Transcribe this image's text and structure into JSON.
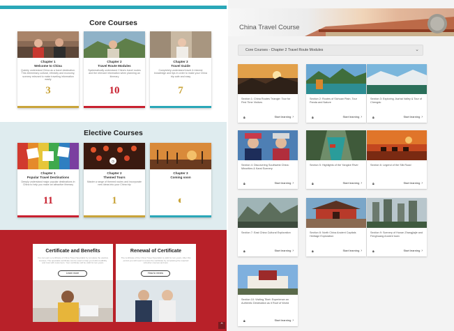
{
  "left_page": {
    "core": {
      "title": "Core Courses",
      "cards": [
        {
          "chapter": "Chapter 1",
          "name": "Welcome to China",
          "desc": "Quickly understand China as a travel destination. This elementary cultural, ethnicity and economy, scenery relevant to make traveling information easily",
          "number": "3",
          "number_color": "#c9a43a",
          "bar_color": "#c9a43a"
        },
        {
          "chapter": "Chapter 2",
          "name": "Travel Route Modules",
          "desc": "Systematically understand China's travel routes and the relevant information when planning an itinerary",
          "number": "10",
          "number_color": "#c8202f",
          "bar_color": "#c8202f"
        },
        {
          "chapter": "Chapter 3",
          "name": "Travel Guide",
          "desc": "Completely understand travel & interest knowledge and tips in order to make your China trip safe and easy",
          "number": "7",
          "number_color": "#c9a43a",
          "bar_color": "#2aa7b8"
        }
      ]
    },
    "elective": {
      "title": "Elective Courses",
      "cards": [
        {
          "chapter": "Chapter 1",
          "name": "Popular Travel Destinations",
          "desc": "Deeply understand major popular destinations in China to help you make an attractive itinerary",
          "number": "11",
          "number_color": "#c8202f",
          "bar_color": "#c8202f"
        },
        {
          "chapter": "Chapter 2",
          "name": "Themed Tours",
          "desc": "Master a range of themed routes and incorporate new ideas into your China trip",
          "number": "1",
          "number_color": "#c9a43a",
          "bar_color": "#c9a43a"
        },
        {
          "chapter": "Chapter 3",
          "name": "Coming soon",
          "desc": "",
          "number": "◐",
          "number_color": "#c9a43a",
          "bar_color": "#2aa7b8"
        }
      ]
    },
    "certificates": [
      {
        "title": "Certificate and Benefits",
        "text": "You can earn a certificate of China Travel Specialist by complete the elective courses. The specialist certificate can be used to help you build credibility and trust with customers. Your certificate will be valid for two years.",
        "button": "Learn more"
      },
      {
        "title": "Renewal of Certificate",
        "text": "The certificate of the China Travel Specialist is valid for two years. After this period you will need to renew the certificate by completing the required refresher courses and test.",
        "button": "How to renew"
      }
    ]
  },
  "right_page": {
    "banner_title": "China Travel Course",
    "dropdown_label": "Core Courses - Chapter 2 Travel Route Modules",
    "tiles": [
      {
        "text": "Section 1: China Routes Triangle: Tour for First Time Visitors",
        "action": "Start learning"
      },
      {
        "text": "Section 2: Routes of Sichuan Plain, Tour Panda and Nature",
        "action": "Start learning"
      },
      {
        "text": "Section 3: Exploring Jiuzhai Valley & Tour of Chengdu",
        "action": "Start learning"
      },
      {
        "text": "Section 4: Discovering Southwest China: Minorities & Karst Scenery",
        "action": "Start learning"
      },
      {
        "text": "Section 5: Highlights of the Yangtze River",
        "action": "Start learning"
      },
      {
        "text": "Section 6: Legend of the Silk Road",
        "action": "Start learning"
      },
      {
        "text": "Section 7: East China Cultural Exploration",
        "action": "Start learning"
      },
      {
        "text": "Section 8: North China Ancient Capitals Heritage Exploration",
        "action": "Start learning"
      },
      {
        "text": "Section 9: Scenery of Hunan Zhangjiajie and Fenghuang Ancient town",
        "action": "Start learning"
      },
      {
        "text": "Section 10: Visiting Tibet: Experience an Authentic Destination as it Roof of World",
        "action": "Start learning"
      }
    ]
  }
}
